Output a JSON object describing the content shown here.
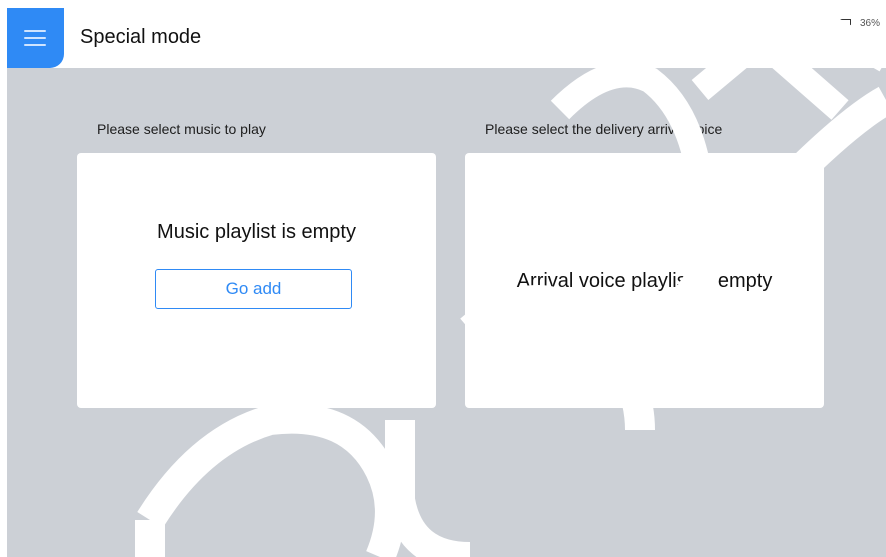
{
  "status_bar": {
    "wifi_icon": "wifi-icon",
    "battery_icon": "battery-icon",
    "battery_percent": "36%"
  },
  "header": {
    "menu_icon": "menu-icon",
    "title": "Special mode"
  },
  "music": {
    "label": "Please select music to play",
    "empty_text": "Music playlist is empty",
    "button_label": "Go add"
  },
  "voice": {
    "label": "Please select the delivery arrival voice",
    "empty_text": "Arrival voice playlist is empty"
  },
  "colors": {
    "accent": "#2f8af5",
    "background": "#ccd0d6",
    "card": "#ffffff"
  }
}
